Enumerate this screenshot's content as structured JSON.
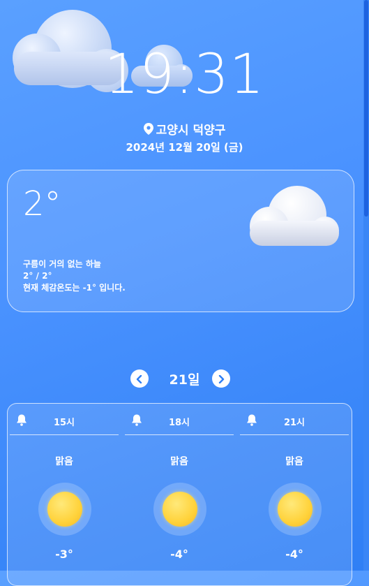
{
  "clock": {
    "time": "19:31"
  },
  "location": {
    "name": "고양시 덕양구",
    "icon": "map-pin-icon"
  },
  "date": {
    "text": "2024년 12월 20일 (금)"
  },
  "current": {
    "temperature": "2°",
    "condition": "구름이 거의 없는 하늘",
    "min_max": "2° / 2°",
    "feels_like": "현재 체감온도는 -1° 입니다.",
    "icon": "cloud-icon"
  },
  "day_nav": {
    "label": "21일",
    "prev_icon": "chevron-left-icon",
    "next_icon": "chevron-right-icon"
  },
  "hourly": [
    {
      "hour": "15시",
      "condition": "맑음",
      "temperature": "-3°",
      "icon": "sun-icon"
    },
    {
      "hour": "18시",
      "condition": "맑음",
      "temperature": "-4°",
      "icon": "sun-icon"
    },
    {
      "hour": "21시",
      "condition": "맑음",
      "temperature": "-4°",
      "icon": "sun-icon"
    }
  ],
  "colors": {
    "accent": "#2f7ff5",
    "background": "#4b93ff",
    "sun": "#ffd23a"
  }
}
